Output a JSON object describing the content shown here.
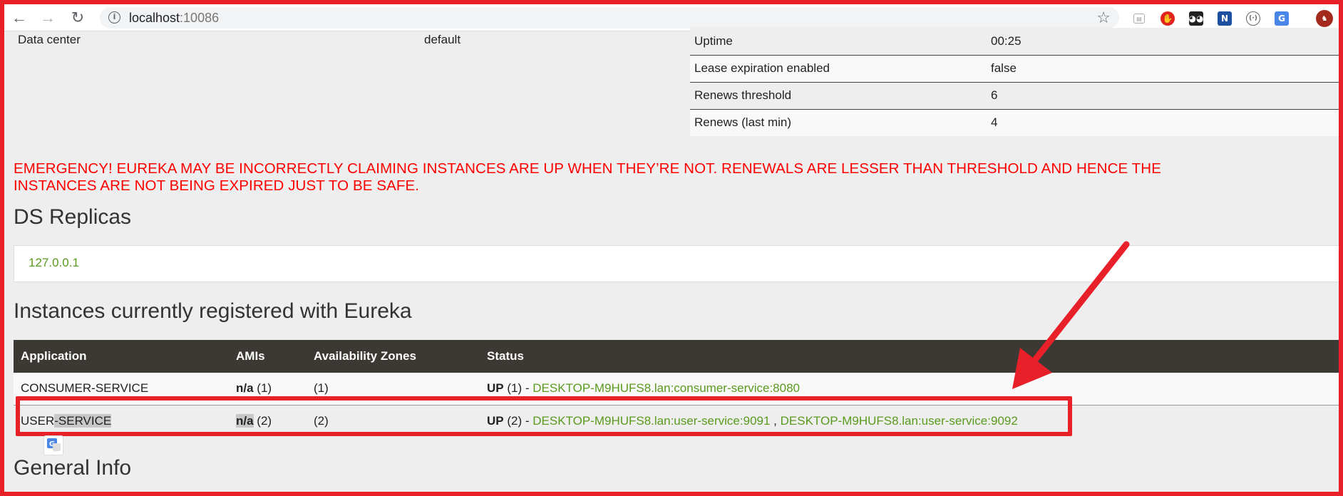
{
  "browser": {
    "url_host": "localhost",
    "url_port": ":10086",
    "back_glyph": "←",
    "forward_glyph": "→",
    "reload_glyph": "↻",
    "star_glyph": "☆",
    "extensions": [
      "reader-icon",
      "adblock-icon",
      "ghost-icon",
      "notion-icon",
      "dev-icon",
      "translate-icon",
      "profile-avatar"
    ]
  },
  "stats": {
    "left": {
      "label": "Data center",
      "value": "default"
    },
    "right": [
      {
        "label": "Uptime",
        "value": "00:25"
      },
      {
        "label": "Lease expiration enabled",
        "value": "false"
      },
      {
        "label": "Renews threshold",
        "value": "6"
      },
      {
        "label": "Renews (last min)",
        "value": "4"
      }
    ]
  },
  "emergency": {
    "line1": "EMERGENCY! EUREKA MAY BE INCORRECTLY CLAIMING INSTANCES ARE UP WHEN THEY’RE NOT. RENEWALS ARE LESSER THAN THRESHOLD AND HENCE THE",
    "line2": "INSTANCES ARE NOT BEING EXPIRED JUST TO BE SAFE."
  },
  "replicas": {
    "heading": "DS Replicas",
    "items": [
      "127.0.0.1"
    ]
  },
  "instances": {
    "heading": "Instances currently registered with Eureka",
    "columns": [
      "Application",
      "AMIs",
      "Availability Zones",
      "Status"
    ],
    "rows": [
      {
        "app": "CONSUMER-SERVICE",
        "ami_na": "n/a",
        "ami_count": " (1)",
        "zones": "(1)",
        "status_prefix": "UP",
        "status_count": " (1) - ",
        "links": [
          "DESKTOP-M9HUFS8.lan:consumer-service:8080"
        ]
      },
      {
        "app_part1": "USER",
        "app_part2": "-SERVICE",
        "ami_na": "n/a",
        "ami_count": " (2)",
        "zones": "(2)",
        "status_prefix": "UP",
        "status_count": " (2) - ",
        "links": [
          "DESKTOP-M9HUFS8.lan:user-service:9091",
          "DESKTOP-M9HUFS8.lan:user-service:9092"
        ],
        "link_sep": " , "
      }
    ]
  },
  "general_info": {
    "heading": "General Info"
  },
  "colors": {
    "emergency": "#ff0000",
    "link": "#5a9a1e",
    "table_header": "#3c3833",
    "annotation": "#e8202a"
  }
}
